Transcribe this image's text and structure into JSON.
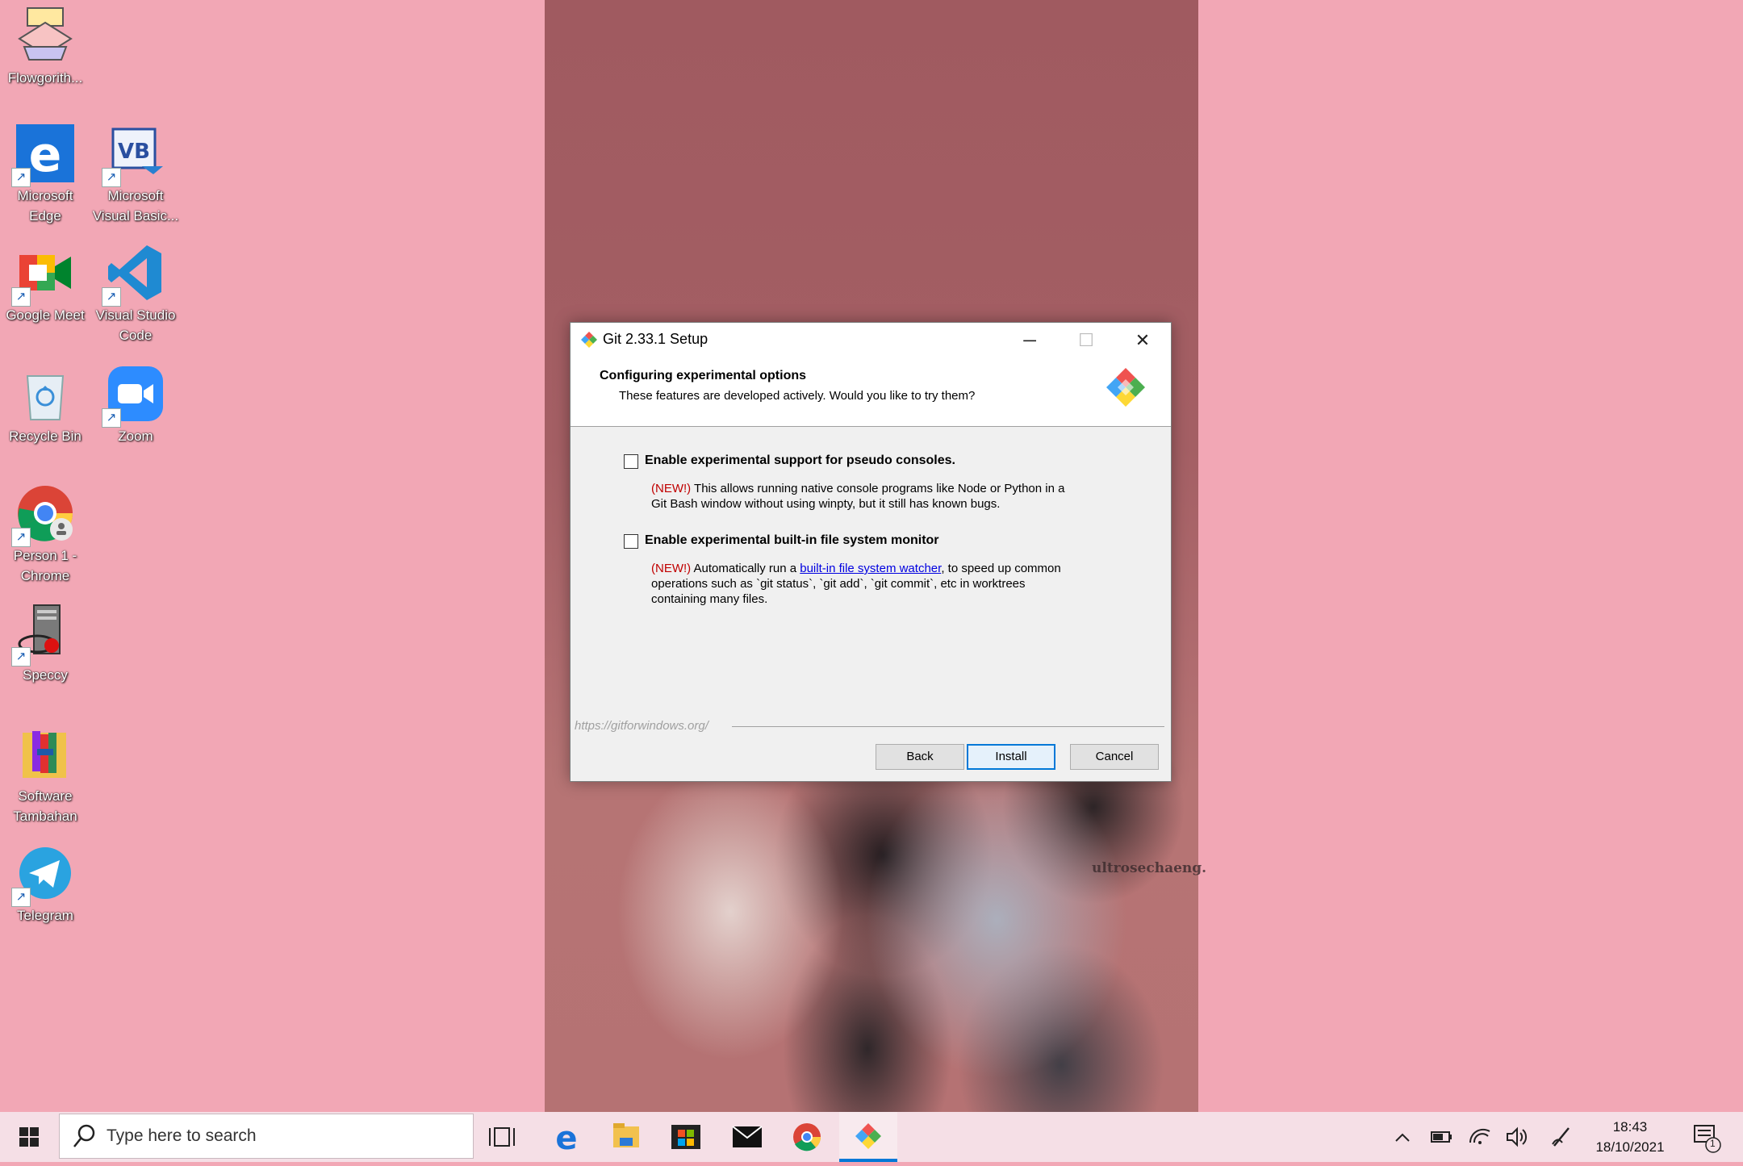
{
  "desktop": {
    "icons": [
      {
        "label": "Flowgorith...",
        "icon": "flowgorithm-icon"
      },
      {
        "label": "Microsoft Edge",
        "icon": "edge-icon"
      },
      {
        "label": "Microsoft Visual Basic...",
        "icon": "visual-basic-icon"
      },
      {
        "label": "Google Meet",
        "icon": "google-meet-icon"
      },
      {
        "label": "Visual Studio Code",
        "icon": "vscode-icon"
      },
      {
        "label": "Recycle Bin",
        "icon": "recycle-bin-icon"
      },
      {
        "label": "Zoom",
        "icon": "zoom-icon"
      },
      {
        "label": "Person 1 - Chrome",
        "icon": "chrome-icon"
      },
      {
        "label": "Speccy",
        "icon": "speccy-icon"
      },
      {
        "label": "Software Tambahan",
        "icon": "folder-icon"
      },
      {
        "label": "Telegram",
        "icon": "telegram-icon"
      }
    ],
    "wallpaper_watermark": "ultrosechaeng."
  },
  "dialog": {
    "title": "Git 2.33.1 Setup",
    "heading": "Configuring experimental options",
    "subheading": "These features are developed actively. Would you like to try them?",
    "options": [
      {
        "label": "Enable experimental support for pseudo consoles.",
        "checked": false,
        "new_tag": "(NEW!)",
        "desc_line1_rest": " This allows running native console programs like Node or Python in a",
        "desc_line2": "Git Bash window without using winpty, but it still has known bugs."
      },
      {
        "label": "Enable experimental built-in file system monitor",
        "checked": false,
        "new_tag": "(NEW!)",
        "desc_pre_link": " Automatically run a ",
        "link_text": "built-in file system watcher",
        "desc_post_link": ", to speed up common",
        "desc_line2": "operations such as `git status`, `git add`, `git commit`, etc in worktrees",
        "desc_line3": "containing many files."
      }
    ],
    "footer_url": "https://gitforwindows.org/",
    "buttons": {
      "back": "Back",
      "install": "Install",
      "cancel": "Cancel"
    }
  },
  "taskbar": {
    "search_placeholder": "Type here to search",
    "clock_time": "18:43",
    "clock_date": "18/10/2021",
    "notification_count": "1"
  },
  "colors": {
    "desktop_bg": "#f2a7b5",
    "accent": "#0078d7",
    "new_tag": "#c00000",
    "link": "#0000e0"
  }
}
